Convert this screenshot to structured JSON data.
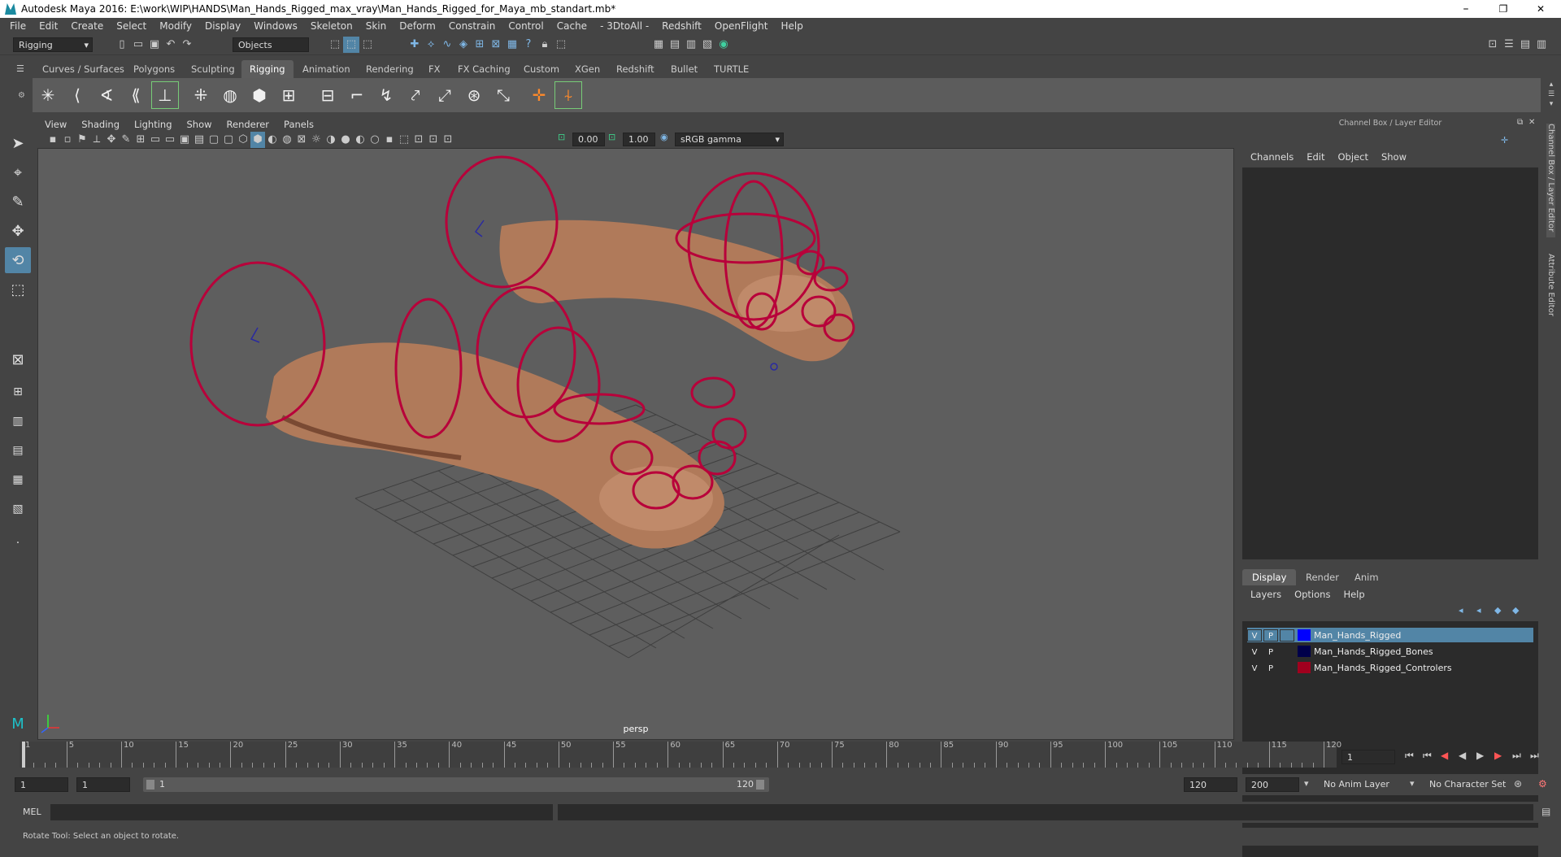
{
  "window": {
    "title": "Autodesk Maya 2016: E:\\work\\WIP\\HANDS\\Man_Hands_Rigged_max_vray\\Man_Hands_Rigged_for_Maya_mb_standart.mb*",
    "minimize": "–",
    "maximize": "❐",
    "close": "✕"
  },
  "menu": [
    "File",
    "Edit",
    "Create",
    "Select",
    "Modify",
    "Display",
    "Windows",
    "Skeleton",
    "Skin",
    "Deform",
    "Constrain",
    "Control",
    "Cache",
    "- 3DtoAll -",
    "Redshift",
    "OpenFlight",
    "Help"
  ],
  "status_line": {
    "menu_set": "Rigging",
    "selection_mode": "Objects"
  },
  "shelf_tabs": [
    "Curves / Surfaces",
    "Polygons",
    "Sculpting",
    "Rigging",
    "Animation",
    "Rendering",
    "FX",
    "FX Caching",
    "Custom",
    "XGen",
    "Redshift",
    "Bullet",
    "TURTLE"
  ],
  "shelf_tab_active": "Rigging",
  "shelf_icons": [
    "joint-tool",
    "ik-handle",
    "ik-spline",
    "insert-joint",
    "mirror-joint",
    "orient-joint",
    "smooth-bind",
    "rigid-bind",
    "paint-weights",
    "lattice",
    "cluster",
    "wrap",
    "blend-shape",
    "point-constraint",
    "orient-constraint",
    "parent-constraint",
    "aim-constraint",
    "pole-vector-constraint",
    "locator",
    "humanik"
  ],
  "viewport": {
    "menu": [
      "View",
      "Shading",
      "Lighting",
      "Show",
      "Renderer",
      "Panels"
    ],
    "near_clip": "0.00",
    "far_clip": "1.00",
    "color_space": "sRGB gamma",
    "camera_label": "persp"
  },
  "channel_box": {
    "title": "Channel Box / Layer Editor",
    "menu": [
      "Channels",
      "Edit",
      "Object",
      "Show"
    ]
  },
  "layer_editor": {
    "tabs": [
      "Display",
      "Render",
      "Anim"
    ],
    "active_tab": "Display",
    "menu": [
      "Layers",
      "Options",
      "Help"
    ],
    "layers": [
      {
        "v": "V",
        "p": "P",
        "name": "Man_Hands_Rigged",
        "color": "#0000ff",
        "selected": true
      },
      {
        "v": "V",
        "p": "P",
        "name": "Man_Hands_Rigged_Bones",
        "color": "#00004a",
        "selected": false
      },
      {
        "v": "V",
        "p": "P",
        "name": "Man_Hands_Rigged_Controlers",
        "color": "#a0001e",
        "selected": false
      }
    ]
  },
  "side_tabs": [
    "Channel Box / Layer Editor",
    "Attribute Editor"
  ],
  "time_slider": {
    "ticks": [
      1,
      5,
      10,
      15,
      20,
      25,
      30,
      35,
      40,
      45,
      50,
      55,
      60,
      65,
      70,
      75,
      80,
      85,
      90,
      95,
      100,
      105,
      110,
      115,
      120
    ],
    "current_frame": "1"
  },
  "range_slider": {
    "start_time": "1",
    "playback_start": "1",
    "range_start_label": "1",
    "range_end_label": "120",
    "playback_end": "120",
    "end_time": "200",
    "anim_layer": "No Anim Layer",
    "character_set": "No Character Set"
  },
  "command_line": {
    "label": "MEL"
  },
  "help_line": "Rotate Tool: Select an object to rotate."
}
